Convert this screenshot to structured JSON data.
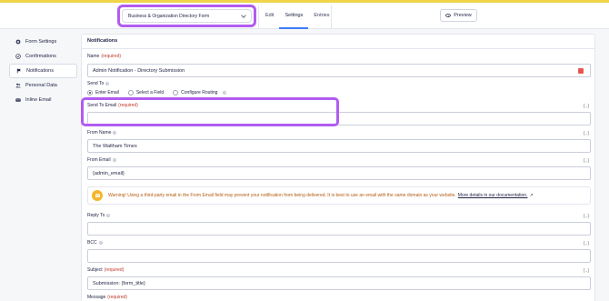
{
  "topbar": {
    "form_selector": "Business & Organization Directory Form",
    "nav": [
      "Edit",
      "Settings",
      "Entries"
    ],
    "preview_label": "Preview"
  },
  "sidebar": {
    "items": [
      {
        "label": "Form Settings",
        "icon": "gear-icon"
      },
      {
        "label": "Confirmations",
        "icon": "check-circle-icon"
      },
      {
        "label": "Notifications",
        "icon": "flag-icon"
      },
      {
        "label": "Personal Data",
        "icon": "users-icon"
      },
      {
        "label": "Inline Email",
        "icon": "envelope-icon"
      }
    ]
  },
  "notifications": {
    "header": "Notifications",
    "required": "(required)",
    "name_label": "Name",
    "name_value": "Admin Notification - Directory Submission",
    "send_to_label": "Send To",
    "send_to_options": [
      "Enter Email",
      "Select a Field",
      "Configure Routing"
    ],
    "send_to_email_label": "Send To Email",
    "send_to_email_value": "",
    "from_name_label": "From Name",
    "from_name_value": "The Waltham Times",
    "from_email_label": "From Email",
    "from_email_value": "{admin_email}",
    "warning_text": "Warning! Using a third-party email in the From Email field may prevent your notification from being delivered. It is best to use an email with the same domain as your website.",
    "warning_link": "More details in our documentation.",
    "reply_to_label": "Reply To",
    "reply_to_value": "",
    "bcc_label": "BCC",
    "bcc_value": "",
    "subject_label": "Subject",
    "subject_value": "Submission: {form_title}",
    "message_label": "Message",
    "merge_tag": "{..}"
  }
}
